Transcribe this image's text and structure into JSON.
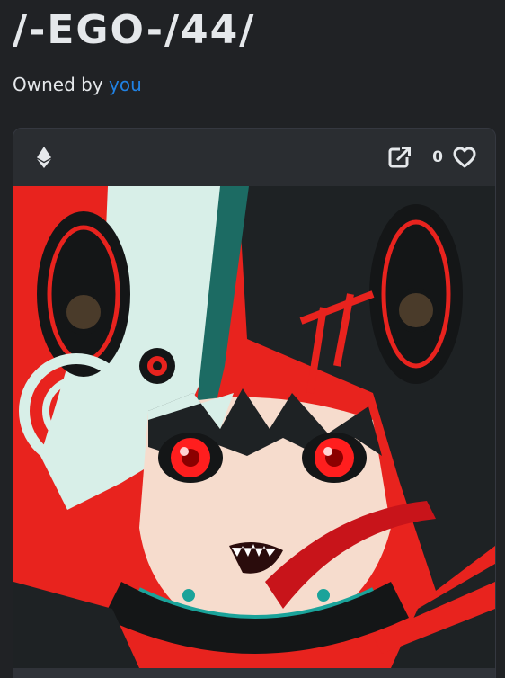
{
  "item": {
    "title": "/-EGO-/44/",
    "owned_by_prefix": "Owned by ",
    "owner": "you"
  },
  "card": {
    "chain_icon": "ethereum-icon",
    "open_icon": "open-in-new-icon",
    "favorite_icon": "heart-outline-icon",
    "favorite_count": "0"
  },
  "colors": {
    "background": "#202225",
    "card_header": "#2a2d31",
    "link": "#2081e2",
    "text": "#e5e8eb"
  }
}
